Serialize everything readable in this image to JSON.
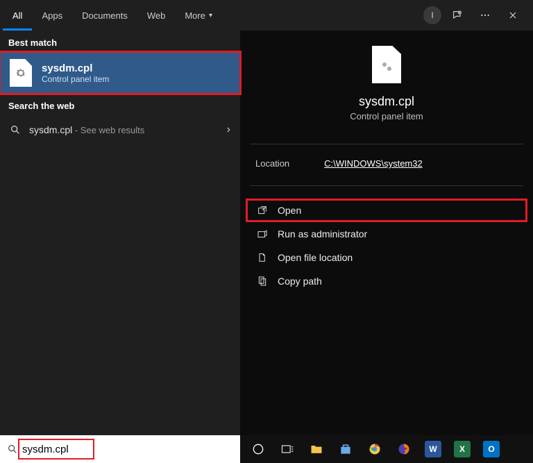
{
  "tabs": {
    "all": "All",
    "apps": "Apps",
    "documents": "Documents",
    "web": "Web",
    "more": "More"
  },
  "avatar_initial": "I",
  "left": {
    "best_match_label": "Best match",
    "result_title": "sysdm.cpl",
    "result_subtitle": "Control panel item",
    "search_web_label": "Search the web",
    "web_term": "sysdm.cpl",
    "web_suffix": " - See web results"
  },
  "right": {
    "title": "sysdm.cpl",
    "subtitle": "Control panel item",
    "location_label": "Location",
    "location_value": "C:\\WINDOWS\\system32",
    "open": "Open",
    "run_admin": "Run as administrator",
    "open_location": "Open file location",
    "copy_path": "Copy path"
  },
  "search_input": "sysdm.cpl",
  "taskbar_apps": {
    "chrome": "Chrome",
    "firefox": "Firefox",
    "word": "W",
    "excel": "X",
    "outlook": "O"
  }
}
